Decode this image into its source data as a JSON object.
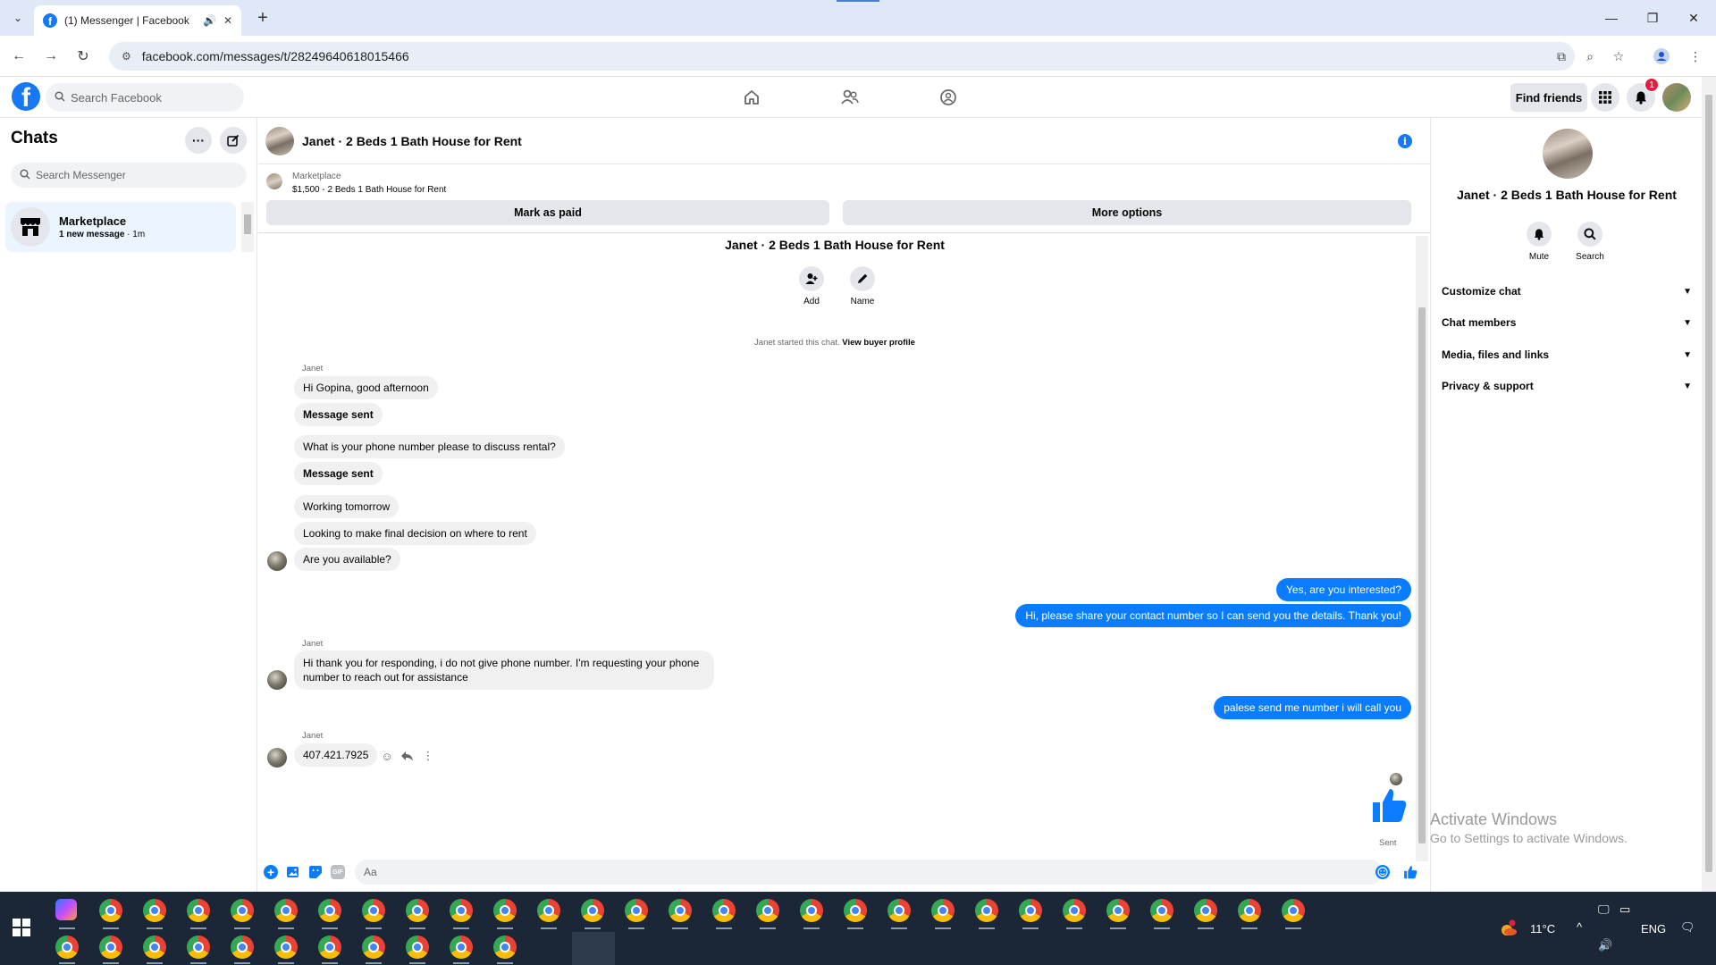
{
  "browser": {
    "tab_title": "(1) Messenger | Facebook",
    "url": "facebook.com/messages/t/28249640618015466"
  },
  "fb_header": {
    "search_placeholder": "Search Facebook",
    "find_friends": "Find friends",
    "notification_count": "1"
  },
  "chats": {
    "title": "Chats",
    "search_placeholder": "Search Messenger",
    "items": [
      {
        "name": "Marketplace",
        "preview": "1 new message",
        "time": "· 1m"
      }
    ]
  },
  "conversation": {
    "title": "Janet · 2 Beds 1 Bath House for Rent",
    "marketplace_label": "Marketplace",
    "listing": "$1,500 - 2 Beds 1 Bath House for Rent",
    "mark_paid": "Mark as paid",
    "more_options": "More options",
    "header_title": "Janet · 2 Beds 1 Bath House for Rent",
    "actions": {
      "add": "Add",
      "name": "Name"
    },
    "started_text": "Janet started this chat.",
    "view_profile": "View buyer profile",
    "sender_name": "Janet",
    "messages_in_1": [
      "Hi Gopina, good afternoon",
      "Message sent",
      "What is your phone number please to discuss rental?",
      "Message sent",
      "Working tomorrow",
      "Looking to make final decision on where to rent",
      "Are you available?"
    ],
    "messages_out_1": [
      "Yes, are you interested?",
      "Hi, please share your contact number so I can send you the details. Thank you!"
    ],
    "message_in_2": "Hi thank you for responding, i do not give  phone number. I'm requesting your phone number to reach out for assistance",
    "message_out_2": "palese send me number i will call you",
    "message_in_3": "407.421.7925",
    "sent_label": "Sent",
    "composer_placeholder": "Aa"
  },
  "info_panel": {
    "title": "Janet · 2 Beds 1 Bath House for Rent",
    "mute": "Mute",
    "search": "Search",
    "rows": [
      "Customize chat",
      "Chat members",
      "Media, files and links",
      "Privacy & support"
    ]
  },
  "watermark": {
    "line1": "Activate Windows",
    "line2": "Go to Settings to activate Windows."
  },
  "taskbar": {
    "temperature": "11°C",
    "language": "ENG"
  },
  "colors": {
    "fb_blue": "#1877f2",
    "outgoing_bubble": "#0a7cff",
    "incoming_bubble": "#f0f0f0",
    "taskbar": "#1b2736"
  }
}
